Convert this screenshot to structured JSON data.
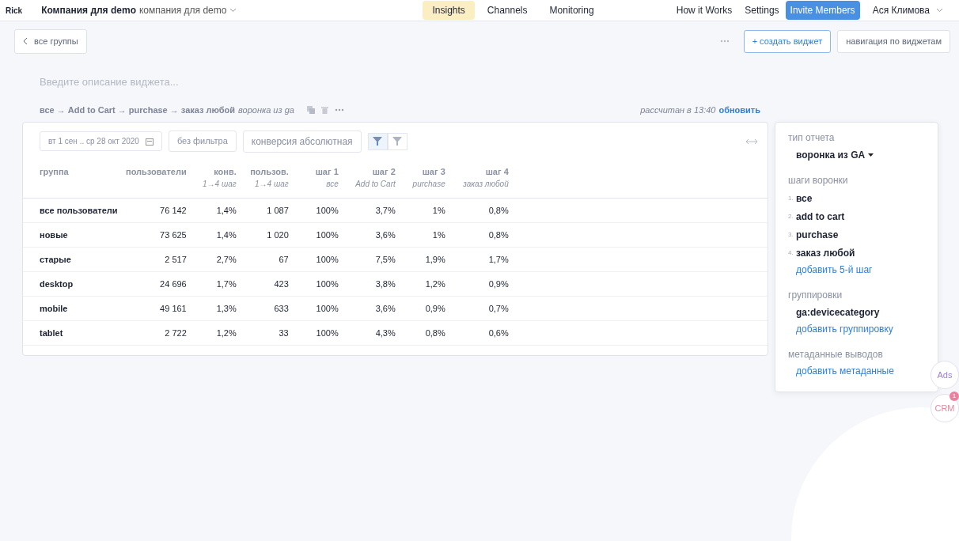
{
  "topbar": {
    "brand": "Rick",
    "company_bold": "Компания для demo",
    "company": "компания для demo",
    "tabs": [
      {
        "label": "Insights",
        "selected": true
      },
      {
        "label": "Channels",
        "selected": false
      },
      {
        "label": "Monitoring",
        "selected": false
      }
    ],
    "links": [
      "How it Works",
      "Settings"
    ],
    "invite": "Invite Members",
    "user": "Ася Климова"
  },
  "toolbar": {
    "back": "все группы",
    "create": "+ создать виджет",
    "navigate": "навигация по виджетам"
  },
  "description": {
    "placeholder": "Введите описание виджета..."
  },
  "widget_path": {
    "steps": "все → Add to Cart → purchase → заказ любой",
    "source": "воронка из ga",
    "calculated": "рассчитан в 13:40",
    "refresh": "обновить"
  },
  "filters": {
    "date": "вт 1 сен .. ср 28 окт 2020",
    "filter": "без фильтра",
    "conversion": "конверсия абсолютная",
    "funnel_toggles": [
      {
        "selected": true
      },
      {
        "selected": false
      }
    ]
  },
  "table": {
    "columns": [
      {
        "label": "группа"
      },
      {
        "label": "пользователи"
      },
      {
        "label": "конв.",
        "sub": "1→4 шаг"
      },
      {
        "label": "пользов.",
        "sub": "1→4 шаг"
      },
      {
        "label": "шаг 1",
        "sub": "все"
      },
      {
        "label": "шаг 2",
        "sub": "Add to Cart"
      },
      {
        "label": "шаг 3",
        "sub": "purchase"
      },
      {
        "label": "шаг 4",
        "sub": "заказ любой"
      }
    ],
    "rows": [
      [
        "все пользователи",
        "76 142",
        "1,4%",
        "1 087",
        "100%",
        "3,7%",
        "1%",
        "0,8%"
      ],
      [
        "новые",
        "73 625",
        "1,4%",
        "1 020",
        "100%",
        "3,6%",
        "1%",
        "0,8%"
      ],
      [
        "старые",
        "2 517",
        "2,7%",
        "67",
        "100%",
        "7,5%",
        "1,9%",
        "1,7%"
      ],
      [
        "desktop",
        "24 696",
        "1,7%",
        "423",
        "100%",
        "3,8%",
        "1,2%",
        "0,9%"
      ],
      [
        "mobile",
        "49 161",
        "1,3%",
        "633",
        "100%",
        "3,6%",
        "0,9%",
        "0,7%"
      ],
      [
        "tablet",
        "2 722",
        "1,2%",
        "33",
        "100%",
        "4,3%",
        "0,8%",
        "0,6%"
      ]
    ]
  },
  "settings": {
    "report_type_label": "тип отчета",
    "report_type": "воронка из GA",
    "steps_label": "шаги воронки",
    "steps": [
      {
        "number": "1.",
        "name": "все"
      },
      {
        "number": "2.",
        "name": "add to cart"
      },
      {
        "number": "3.",
        "name": "purchase"
      },
      {
        "number": "4.",
        "name": "заказ любой"
      }
    ],
    "add_step": "добавить 5-й шаг",
    "groupings_label": "группировки",
    "groupings": [
      "ga:devicecategory"
    ],
    "add_grouping": "добавить группировку",
    "metadata_label": "метаданные выводов",
    "add_metadata": "добавить метаданные"
  },
  "floating": {
    "ads": "Ads",
    "crm": "CRM",
    "crm_badge": "1"
  }
}
